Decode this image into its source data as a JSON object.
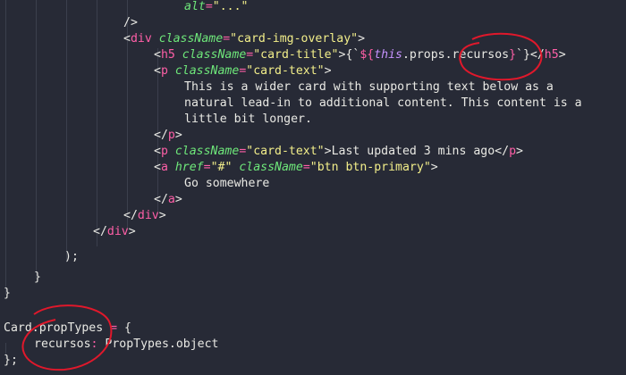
{
  "editor": {
    "lines": [
      [
        {
          "t": "alt",
          "c": "a"
        },
        {
          "t": "=",
          "c": "e"
        },
        {
          "t": "\"...\"",
          "c": "s"
        }
      ],
      [
        {
          "t": "/>",
          "c": "p"
        }
      ],
      [
        {
          "t": "<",
          "c": "p"
        },
        {
          "t": "div",
          "c": "k"
        },
        {
          "t": " ",
          "c": "p"
        },
        {
          "t": "className",
          "c": "a"
        },
        {
          "t": "=",
          "c": "e"
        },
        {
          "t": "\"card-img-overlay\"",
          "c": "s"
        },
        {
          "t": ">",
          "c": "p"
        }
      ],
      [
        {
          "t": "<",
          "c": "p"
        },
        {
          "t": "h5",
          "c": "k"
        },
        {
          "t": " ",
          "c": "p"
        },
        {
          "t": "className",
          "c": "a"
        },
        {
          "t": "=",
          "c": "e"
        },
        {
          "t": "\"card-title\"",
          "c": "s"
        },
        {
          "t": ">{`",
          "c": "p"
        },
        {
          "t": "${",
          "c": "k"
        },
        {
          "t": "this",
          "c": "th"
        },
        {
          "t": ".props.recursos",
          "c": "p"
        },
        {
          "t": "}",
          "c": "k"
        },
        {
          "t": "`}</",
          "c": "p"
        },
        {
          "t": "h5",
          "c": "k"
        },
        {
          "t": ">",
          "c": "p"
        }
      ],
      [
        {
          "t": "<",
          "c": "p"
        },
        {
          "t": "p",
          "c": "k"
        },
        {
          "t": " ",
          "c": "p"
        },
        {
          "t": "className",
          "c": "a"
        },
        {
          "t": "=",
          "c": "e"
        },
        {
          "t": "\"card-text\"",
          "c": "s"
        },
        {
          "t": ">",
          "c": "p"
        }
      ],
      [
        {
          "t": "This is a wider card with supporting text below as a",
          "c": "p"
        }
      ],
      [
        {
          "t": "natural lead-in to additional content. This content is a",
          "c": "p"
        }
      ],
      [
        {
          "t": "little bit longer.",
          "c": "p"
        }
      ],
      [
        {
          "t": "</",
          "c": "p"
        },
        {
          "t": "p",
          "c": "k"
        },
        {
          "t": ">",
          "c": "p"
        }
      ],
      [
        {
          "t": "<",
          "c": "p"
        },
        {
          "t": "p",
          "c": "k"
        },
        {
          "t": " ",
          "c": "p"
        },
        {
          "t": "className",
          "c": "a"
        },
        {
          "t": "=",
          "c": "e"
        },
        {
          "t": "\"card-text\"",
          "c": "s"
        },
        {
          "t": ">Last updated 3 mins ago</",
          "c": "p"
        },
        {
          "t": "p",
          "c": "k"
        },
        {
          "t": ">",
          "c": "p"
        }
      ],
      [
        {
          "t": "<",
          "c": "p"
        },
        {
          "t": "a",
          "c": "k"
        },
        {
          "t": " ",
          "c": "p"
        },
        {
          "t": "href",
          "c": "a"
        },
        {
          "t": "=",
          "c": "e"
        },
        {
          "t": "\"#\"",
          "c": "s"
        },
        {
          "t": " ",
          "c": "p"
        },
        {
          "t": "className",
          "c": "a"
        },
        {
          "t": "=",
          "c": "e"
        },
        {
          "t": "\"btn btn-primary\"",
          "c": "s"
        },
        {
          "t": ">",
          "c": "p"
        }
      ],
      [
        {
          "t": "Go somewhere",
          "c": "p"
        }
      ],
      [
        {
          "t": "</",
          "c": "p"
        },
        {
          "t": "a",
          "c": "k"
        },
        {
          "t": ">",
          "c": "p"
        }
      ],
      [
        {
          "t": "</",
          "c": "p"
        },
        {
          "t": "div",
          "c": "k"
        },
        {
          "t": ">",
          "c": "p"
        }
      ],
      [
        {
          "t": "</",
          "c": "p"
        },
        {
          "t": "div",
          "c": "k"
        },
        {
          "t": ">",
          "c": "p"
        }
      ],
      [
        {
          "t": ");",
          "c": "p"
        }
      ],
      [
        {
          "t": "}",
          "c": "p"
        }
      ],
      [
        {
          "t": "}",
          "c": "p"
        }
      ],
      [],
      [
        {
          "t": "Card",
          "c": "p"
        },
        {
          "t": ".propTypes ",
          "c": "p"
        },
        {
          "t": "=",
          "c": "e"
        },
        {
          "t": " {",
          "c": "p"
        }
      ],
      [
        {
          "t": "recursos",
          "c": "p"
        },
        {
          "t": ":",
          "c": "e"
        },
        {
          "t": " PropTypes.object",
          "c": "p"
        }
      ],
      [
        {
          "t": "};",
          "c": "p"
        }
      ]
    ]
  },
  "colors": {
    "background": "#272a36",
    "plain": "#e9e9e4",
    "tag": "#ff5fa7",
    "string": "#f2ee8a",
    "attribute": "#6ee77a",
    "this_keyword": "#c693ff",
    "annotation": "#e0182b"
  }
}
